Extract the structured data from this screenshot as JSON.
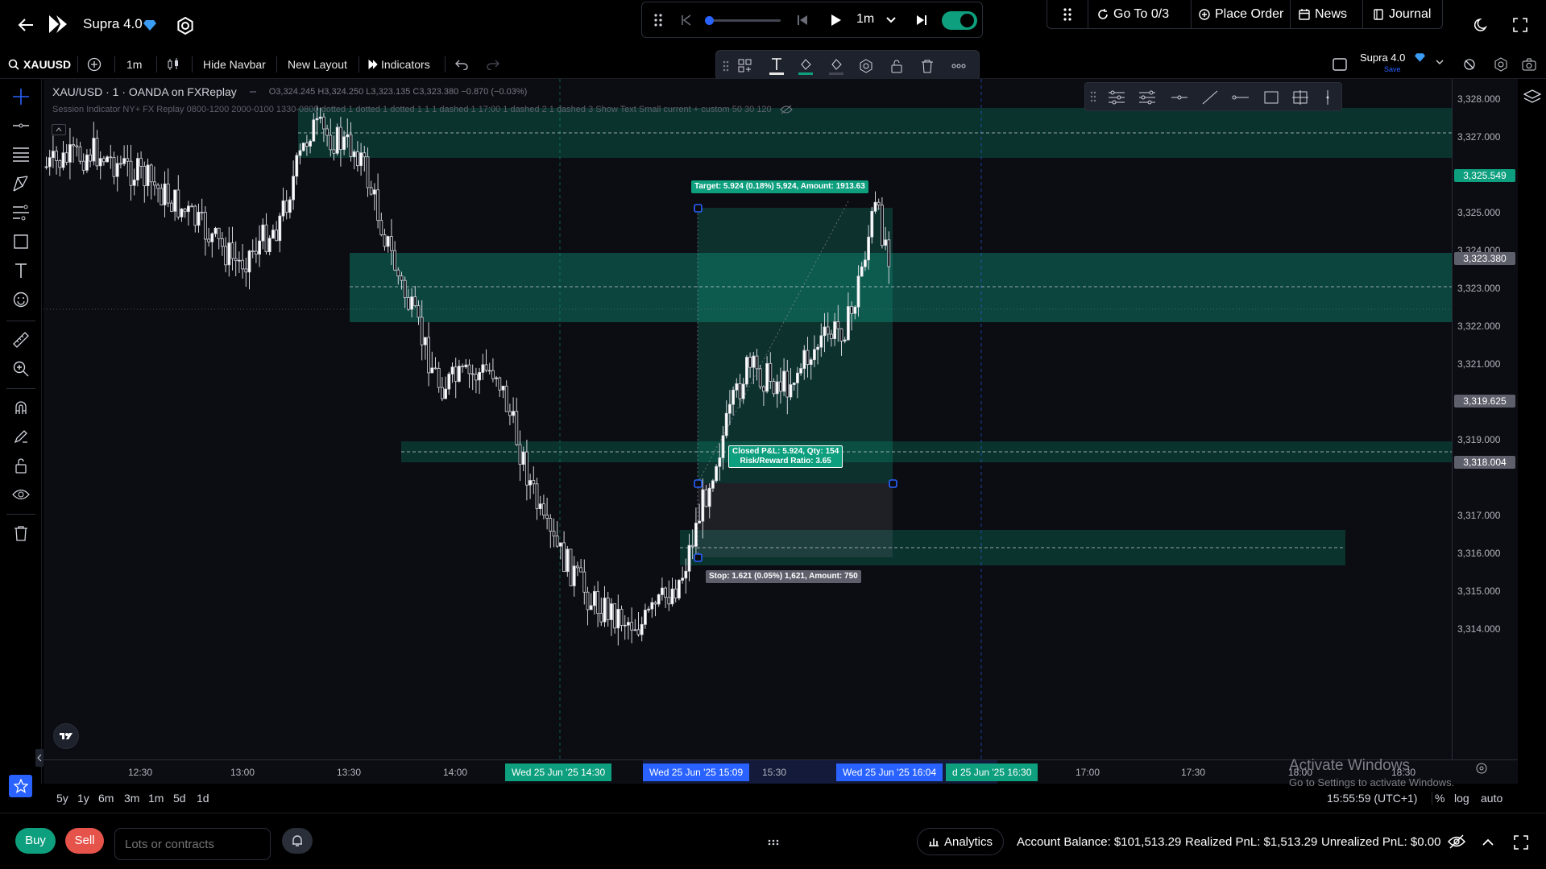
{
  "header": {
    "app_name": "Supra 4.0",
    "playback_interval": "1m",
    "goto_label": "Go To 0/3",
    "place_order_label": "Place Order",
    "news_label": "News",
    "journal_label": "Journal"
  },
  "toolbar": {
    "symbol": "XAUUSD",
    "interval": "1m",
    "hide_navbar": "Hide Navbar",
    "new_layout": "New Layout",
    "indicators": "Indicators",
    "layout_name": "Supra 4.0",
    "layout_status": "Save"
  },
  "legend": {
    "title": "XAU/USD · 1 · OANDA on FXReplay",
    "o_label": "O",
    "o_value": "3,324.245",
    "h_label": "H",
    "h_value": "3,324.250",
    "l_label": "L",
    "l_value": "3,323.135",
    "c_label": "C",
    "c_value": "3,323.380",
    "change": "−0.870 (−0.03%)",
    "indicator_line": "Session Indicator NY+ FX Replay 0800-1200 2000-0100 1330-0800 dotted 1 dotted 1 dotted 1 1 1 dashed 1 17:00 1 dashed 2 1 dashed 3 Show Text Small current + custom 50 30 120"
  },
  "position": {
    "target_label": "Target: 5.924 (0.18%) 5,924, Amount: 1913.63",
    "closed_line1": "Closed P&L: 5.924, Qty: 154",
    "closed_line2": "Risk/Reward Ratio: 3.65",
    "stop_label": "Stop: 1.621 (0.05%) 1,621, Amount: 750"
  },
  "price_axis": {
    "ticks": [
      "3,328.000",
      "3,327.000",
      "3,326.000",
      "3,325.000",
      "3,324.000",
      "3,323.000",
      "3,322.000",
      "3,321.000",
      "3,320.000",
      "3,319.000",
      "3,317.000",
      "3,316.000",
      "3,315.000",
      "3,314.000"
    ],
    "target_price": "3,325.549",
    "current_price": "3,323.380",
    "entry_price": "3,319.625",
    "stop_price": "3,318.004"
  },
  "time_axis": {
    "ticks": [
      "12:30",
      "13:00",
      "13:30",
      "14:00",
      "15:30",
      "17:00",
      "17:30",
      "18:00",
      "18:30"
    ],
    "label_left": "Wed 25 Jun '25   14:30",
    "label_entry": "Wed 25 Jun '25   15:09",
    "label_exit": "Wed 25 Jun '25   16:04",
    "label_cross": "d 25 Jun '25   16:30"
  },
  "watermark": {
    "line1": "Activate Windows",
    "line2": "Go to Settings to activate Windows."
  },
  "range_bar": {
    "ranges": [
      "5y",
      "1y",
      "6m",
      "3m",
      "1m",
      "5d",
      "1d"
    ],
    "clock": "15:55:59 (UTC+1)",
    "pct": "%",
    "log": "log",
    "auto": "auto"
  },
  "footer": {
    "buy": "Buy",
    "sell": "Sell",
    "qty_placeholder": "Lots or contracts",
    "analytics": "Analytics",
    "account_balance": "Account Balance: $101,513.29",
    "realized_pnl": "Realized PnL: $1,513.29",
    "unrealized_pnl": "Unrealized PnL: $0.00"
  },
  "colors": {
    "accent_green": "#0e9f7e",
    "blue": "#2962ff",
    "bg": "#0c0d12"
  }
}
